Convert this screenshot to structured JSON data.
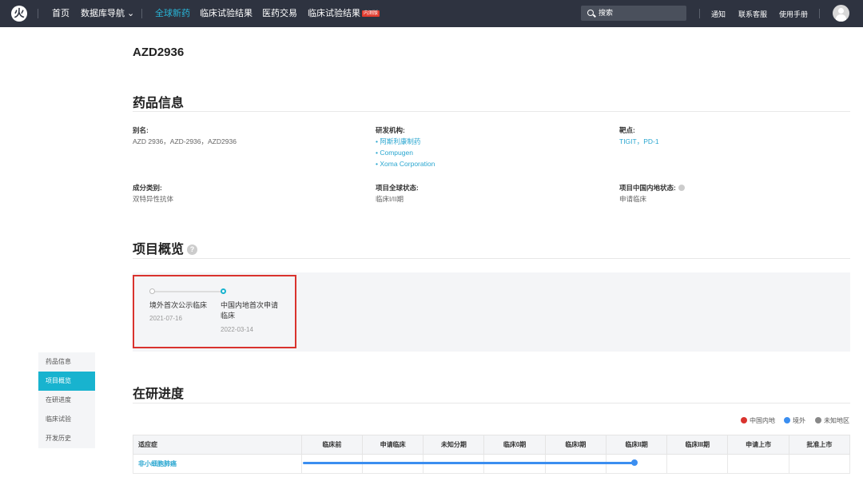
{
  "topbar": {
    "logo": "火",
    "nav": [
      "首页",
      "数据库导航 ⌄",
      "全球新药",
      "临床试验结果",
      "医药交易",
      "临床试验结果"
    ],
    "badge": "内测版",
    "search_placeholder": "搜索",
    "links": [
      "通知",
      "联系客服",
      "使用手册"
    ]
  },
  "drug": {
    "name": "AZD2936"
  },
  "drug_info": {
    "heading": "药品信息",
    "alias_label": "别名:",
    "alias_value": "AZD 2936，AZD-2936，AZD2936",
    "org_label": "研发机构:",
    "orgs": [
      "• 阿斯利康制药",
      "• Compugen",
      "• Xoma Corporation"
    ],
    "target_label": "靶点:",
    "target_value": "TIGIT，PD-1",
    "type_label": "成分类别:",
    "type_value": "双特异性抗体",
    "global_status_label": "项目全球状态:",
    "global_status_value": "临床I/II期",
    "china_status_label": "项目中国内地状态:",
    "china_status_value": "申请临床"
  },
  "overview": {
    "heading": "项目概览",
    "help": "?",
    "milestones": [
      {
        "label": "境外首次公示临床",
        "date": "2021-07-16"
      },
      {
        "label1": "中国内地首次申请",
        "label2": "临床",
        "date": "2022-03-14"
      }
    ]
  },
  "sidenav": [
    "药品信息",
    "项目概览",
    "在研进度",
    "临床试验",
    "开发历史"
  ],
  "progress": {
    "heading": "在研进度",
    "legend": [
      "中国内地",
      "境外",
      "未知地区"
    ],
    "columns": [
      "适应症",
      "临床前",
      "申请临床",
      "未知分期",
      "临床0期",
      "临床I期",
      "临床II期",
      "临床III期",
      "申请上市",
      "批准上市"
    ],
    "rows": [
      {
        "indication": "非小细胞肺癌",
        "reached_stage": "临床II期"
      }
    ]
  },
  "colors": {
    "accent": "#18b3cf",
    "link": "#29a6d0",
    "topbar": "#2e3340",
    "china": "#d9332e",
    "overseas": "#3b8ef0",
    "unknown": "#888888",
    "highlight_border": "#d9332e"
  }
}
